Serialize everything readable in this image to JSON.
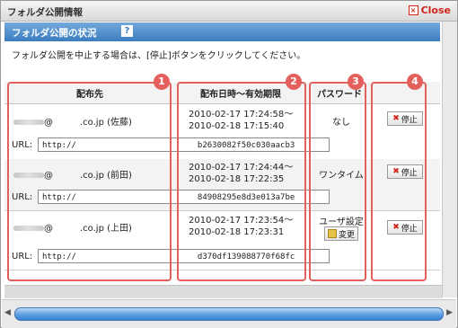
{
  "window": {
    "title": "フォルダ公開情報",
    "close_label": "Close"
  },
  "section": {
    "title": "フォルダ公開の状況",
    "help": "?"
  },
  "instruction": "フォルダ公開を中止する場合は、[停止]ボタンをクリックしてください。",
  "columns": {
    "recipient": "配布先",
    "dates": "配布日時～有効期限",
    "password": "パスワード"
  },
  "badges": [
    "1",
    "2",
    "3",
    "4"
  ],
  "rows": [
    {
      "email": "@　　　.co.jp (佐藤)",
      "date_from": "2010-02-17 17:24:58～",
      "date_to": "2010-02-18 17:15:40",
      "password": "なし",
      "has_change": false,
      "stop": "停止",
      "url_label": "URL:",
      "url": "http://　　　　　　　　　　　　　　　b2630082f50c030aacb3"
    },
    {
      "email": "@　　　.co.jp (前田)",
      "date_from": "2010-02-17 17:24:44～",
      "date_to": "2010-02-18 17:22:35",
      "password": "ワンタイム",
      "has_change": false,
      "stop": "停止",
      "url_label": "URL:",
      "url": "http://　　　　　　　　　　　　　　　84908295e8d3e013a7be"
    },
    {
      "email": "@　　　.co.jp (上田)",
      "date_from": "2010-02-17 17:23:54～",
      "date_to": "2010-02-18 17:23:31",
      "password": "ユーザ設定",
      "has_change": true,
      "change": "変更",
      "stop": "停止",
      "url_label": "URL:",
      "url": "http://　　　　　　　　　　　　　　　d370df139088770f68fc"
    }
  ],
  "colors": {
    "accent": "#3b7dc0",
    "annotation": "#e4605c",
    "close": "#d2261b"
  }
}
